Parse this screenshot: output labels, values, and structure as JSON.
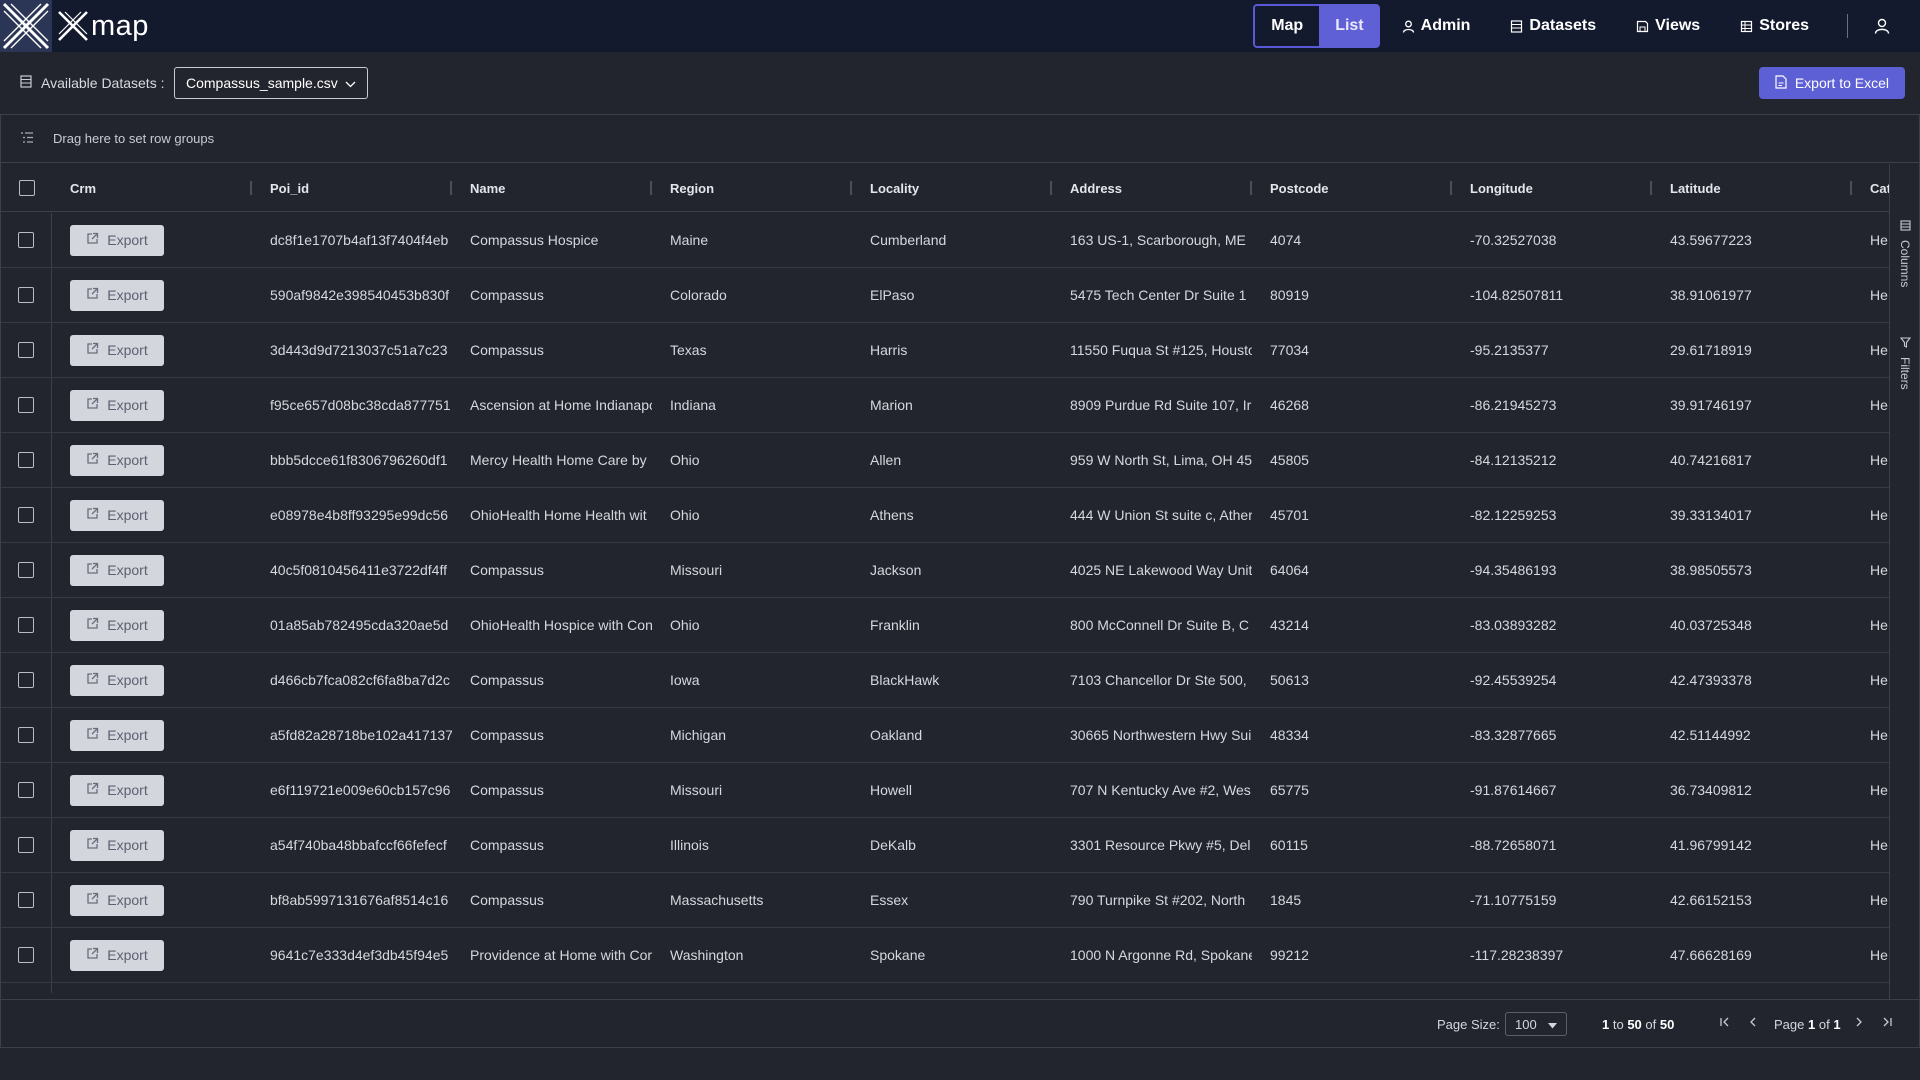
{
  "app": {
    "brand": "map",
    "nav": {
      "map_label": "Map",
      "list_label": "List",
      "admin_label": "Admin",
      "datasets_label": "Datasets",
      "views_label": "Views",
      "stores_label": "Stores"
    }
  },
  "toolbar": {
    "datasets_label": "Available Datasets :",
    "selected_dataset": "Compassus_sample.csv",
    "export_excel_label": "Export to Excel"
  },
  "grid": {
    "group_panel_hint": "Drag here to set row groups",
    "columns": [
      "Crm",
      "Poi_id",
      "Name",
      "Region",
      "Locality",
      "Address",
      "Postcode",
      "Longitude",
      "Latitude",
      "Cat"
    ],
    "export_label": "Export",
    "rows": [
      {
        "poi_id": "dc8f1e1707b4af13f7404f4eb",
        "name": "Compassus Hospice",
        "region": "Maine",
        "locality": "Cumberland",
        "address": "163 US-1, Scarborough, ME",
        "postcode": "4074",
        "longitude": "-70.32527038",
        "latitude": "43.59677223",
        "cat": "He"
      },
      {
        "poi_id": "590af9842e398540453b830f",
        "name": "Compassus",
        "region": "Colorado",
        "locality": "ElPaso",
        "address": "5475 Tech Center Dr Suite 1",
        "postcode": "80919",
        "longitude": "-104.82507811",
        "latitude": "38.91061977",
        "cat": "He"
      },
      {
        "poi_id": "3d443d9d7213037c51a7c23",
        "name": "Compassus",
        "region": "Texas",
        "locality": "Harris",
        "address": "11550 Fuqua St #125, Housto",
        "postcode": "77034",
        "longitude": "-95.2135377",
        "latitude": "29.61718919",
        "cat": "He"
      },
      {
        "poi_id": "f95ce657d08bc38cda877751",
        "name": "Ascension at Home Indianapo",
        "region": "Indiana",
        "locality": "Marion",
        "address": "8909 Purdue Rd Suite 107, Ir",
        "postcode": "46268",
        "longitude": "-86.21945273",
        "latitude": "39.91746197",
        "cat": "He"
      },
      {
        "poi_id": "bbb5dcce61f8306796260df1",
        "name": "Mercy Health Home Care by",
        "region": "Ohio",
        "locality": "Allen",
        "address": "959 W North St, Lima, OH 45",
        "postcode": "45805",
        "longitude": "-84.12135212",
        "latitude": "40.74216817",
        "cat": "He"
      },
      {
        "poi_id": "e08978e4b8ff93295e99dc56",
        "name": "OhioHealth Home Health wit",
        "region": "Ohio",
        "locality": "Athens",
        "address": "444 W Union St suite c, Ather",
        "postcode": "45701",
        "longitude": "-82.12259253",
        "latitude": "39.33134017",
        "cat": "He"
      },
      {
        "poi_id": "40c5f0810456411e3722df4ff",
        "name": "Compassus",
        "region": "Missouri",
        "locality": "Jackson",
        "address": "4025 NE Lakewood Way Unit",
        "postcode": "64064",
        "longitude": "-94.35486193",
        "latitude": "38.98505573",
        "cat": "He"
      },
      {
        "poi_id": "01a85ab782495cda320ae5d",
        "name": "OhioHealth Hospice with Con",
        "region": "Ohio",
        "locality": "Franklin",
        "address": "800 McConnell Dr Suite B, C",
        "postcode": "43214",
        "longitude": "-83.03893282",
        "latitude": "40.03725348",
        "cat": "He"
      },
      {
        "poi_id": "d466cb7fca082cf6fa8ba7d2c",
        "name": "Compassus",
        "region": "Iowa",
        "locality": "BlackHawk",
        "address": "7103 Chancellor Dr Ste 500,",
        "postcode": "50613",
        "longitude": "-92.45539254",
        "latitude": "42.47393378",
        "cat": "He"
      },
      {
        "poi_id": "a5fd82a28718be102a417137",
        "name": "Compassus",
        "region": "Michigan",
        "locality": "Oakland",
        "address": "30665 Northwestern Hwy Sui",
        "postcode": "48334",
        "longitude": "-83.32877665",
        "latitude": "42.51144992",
        "cat": "He"
      },
      {
        "poi_id": "e6f119721e009e60cb157c96",
        "name": "Compassus",
        "region": "Missouri",
        "locality": "Howell",
        "address": "707 N Kentucky Ave #2, Wes",
        "postcode": "65775",
        "longitude": "-91.87614667",
        "latitude": "36.73409812",
        "cat": "He"
      },
      {
        "poi_id": "a54f740ba48bbafccf66fefecf",
        "name": "Compassus",
        "region": "Illinois",
        "locality": "DeKalb",
        "address": "3301 Resource Pkwy #5, Del",
        "postcode": "60115",
        "longitude": "-88.72658071",
        "latitude": "41.96799142",
        "cat": "He"
      },
      {
        "poi_id": "bf8ab5997131676af8514c16",
        "name": "Compassus",
        "region": "Massachusetts",
        "locality": "Essex",
        "address": "790 Turnpike St #202, North",
        "postcode": "1845",
        "longitude": "-71.10775159",
        "latitude": "42.66152153",
        "cat": "He"
      },
      {
        "poi_id": "9641c7e333d4ef3db45f94e5",
        "name": "Providence at Home with Cor",
        "region": "Washington",
        "locality": "Spokane",
        "address": "1000 N Argonne Rd, Spokane",
        "postcode": "99212",
        "longitude": "-117.28238397",
        "latitude": "47.66628169",
        "cat": "He"
      }
    ],
    "side_panel": {
      "columns_label": "Columns",
      "filters_label": "Filters"
    },
    "pager": {
      "page_size_label": "Page Size:",
      "page_size": "100",
      "range_from": "1",
      "range_to_word": "to",
      "range_to": "50",
      "of_word": "of",
      "total": "50",
      "page_word": "Page",
      "page": "1",
      "page_of_word": "of",
      "page_count": "1"
    }
  }
}
